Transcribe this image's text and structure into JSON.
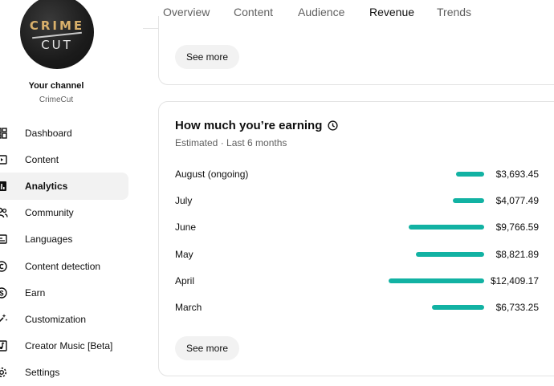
{
  "channel": {
    "logo_line1": "CRIME",
    "logo_line2": "CUT",
    "title": "Your channel",
    "name": "CrimeCut"
  },
  "sidebar": {
    "items": [
      {
        "label": "Dashboard",
        "icon": "dashboard-icon",
        "active": false
      },
      {
        "label": "Content",
        "icon": "content-icon",
        "active": false
      },
      {
        "label": "Analytics",
        "icon": "analytics-icon",
        "active": true
      },
      {
        "label": "Community",
        "icon": "community-icon",
        "active": false
      },
      {
        "label": "Languages",
        "icon": "languages-icon",
        "active": false
      },
      {
        "label": "Content detection",
        "icon": "copyright-icon",
        "active": false
      },
      {
        "label": "Earn",
        "icon": "dollar-icon",
        "active": false
      },
      {
        "label": "Customization",
        "icon": "magic-wand-icon",
        "active": false
      },
      {
        "label": "Creator Music [Beta]",
        "icon": "music-icon",
        "active": false
      },
      {
        "label": "Settings",
        "icon": "gear-icon",
        "active": false
      }
    ]
  },
  "tabs": [
    {
      "label": "Overview",
      "active": false
    },
    {
      "label": "Content",
      "active": false
    },
    {
      "label": "Audience",
      "active": false
    },
    {
      "label": "Revenue",
      "active": true
    },
    {
      "label": "Trends",
      "active": false
    }
  ],
  "card_top": {
    "see_more": "See more"
  },
  "earnings": {
    "title": "How much you’re earning",
    "subtitle": "Estimated · Last 6 months",
    "see_more": "See more",
    "bar_color": "#12b2a3",
    "rows": [
      {
        "month": "August (ongoing)",
        "amount": "$3,693.45",
        "value": 3693.45
      },
      {
        "month": "July",
        "amount": "$4,077.49",
        "value": 4077.49
      },
      {
        "month": "June",
        "amount": "$9,766.59",
        "value": 9766.59
      },
      {
        "month": "May",
        "amount": "$8,821.89",
        "value": 8821.89
      },
      {
        "month": "April",
        "amount": "$12,409.17",
        "value": 12409.17
      },
      {
        "month": "March",
        "amount": "$6,733.25",
        "value": 6733.25
      }
    ]
  }
}
